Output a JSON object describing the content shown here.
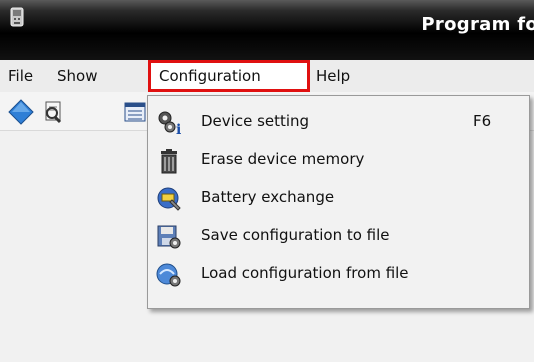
{
  "window": {
    "title": "Program fo",
    "app_icon": "app-icon"
  },
  "menubar": {
    "items": [
      {
        "label": "File"
      },
      {
        "label": "Show"
      },
      {
        "label": "Configuration",
        "highlight_color": "#e01010"
      },
      {
        "label": "Help"
      }
    ]
  },
  "toolbar": {
    "icons": [
      "diamond-icon",
      "search-document-icon",
      "list-icon"
    ]
  },
  "dropdown": {
    "items": [
      {
        "label": "Device setting",
        "shortcut": "F6",
        "icon": "gear-info-icon"
      },
      {
        "label": "Erase device memory",
        "icon": "trash-icon"
      },
      {
        "label": "Battery exchange",
        "icon": "battery-wrench-icon"
      },
      {
        "label": "Save configuration to file",
        "icon": "save-config-icon"
      },
      {
        "label": "Load configuration from file",
        "icon": "load-config-icon"
      }
    ]
  }
}
